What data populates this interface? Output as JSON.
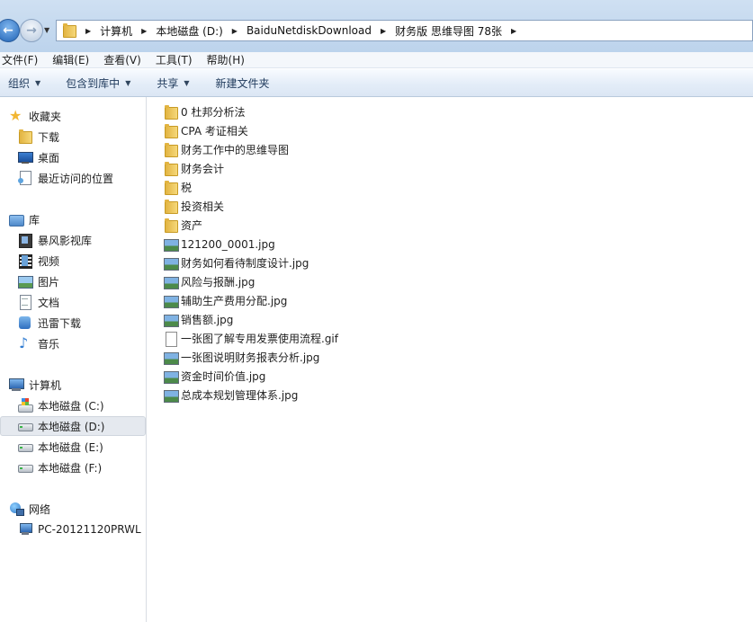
{
  "address": {
    "crumbs": [
      "计算机",
      "本地磁盘 (D:)",
      "BaiduNetdiskDownload",
      "财务版 思维导图 78张"
    ]
  },
  "menubar": {
    "items": [
      "文件(F)",
      "编辑(E)",
      "查看(V)",
      "工具(T)",
      "帮助(H)"
    ]
  },
  "toolbar": {
    "organize": "组织",
    "include_library": "包含到库中",
    "share": "共享",
    "new_folder": "新建文件夹"
  },
  "navpane": {
    "favorites": "收藏夹",
    "fav_items": [
      "下载",
      "桌面",
      "最近访问的位置"
    ],
    "libraries": "库",
    "lib_items": [
      "暴风影视库",
      "视频",
      "图片",
      "文档",
      "迅雷下载",
      "音乐"
    ],
    "computer": "计算机",
    "drives": [
      "本地磁盘 (C:)",
      "本地磁盘 (D:)",
      "本地磁盘 (E:)",
      "本地磁盘 (F:)"
    ],
    "network": "网络",
    "network_items": [
      "PC-20121120PRWL"
    ]
  },
  "files": [
    {
      "name": "0 杜邦分析法",
      "type": "folder"
    },
    {
      "name": "CPA 考证相关",
      "type": "folder"
    },
    {
      "name": "财务工作中的思维导图",
      "type": "folder"
    },
    {
      "name": "财务会计",
      "type": "folder"
    },
    {
      "name": "税",
      "type": "folder"
    },
    {
      "name": "投资相关",
      "type": "folder"
    },
    {
      "name": "资产",
      "type": "folder"
    },
    {
      "name": "121200_0001.jpg",
      "type": "image"
    },
    {
      "name": "财务如何看待制度设计.jpg",
      "type": "image"
    },
    {
      "name": "风险与报酬.jpg",
      "type": "image"
    },
    {
      "name": "辅助生产费用分配.jpg",
      "type": "image"
    },
    {
      "name": "销售额.jpg",
      "type": "image"
    },
    {
      "name": "一张图了解专用发票使用流程.gif",
      "type": "document"
    },
    {
      "name": "一张图说明财务报表分析.jpg",
      "type": "image"
    },
    {
      "name": "资金时间价值.jpg",
      "type": "image"
    },
    {
      "name": "总成本规划管理体系.jpg",
      "type": "image"
    }
  ],
  "colors": {
    "titlebar": "#cfe0f2",
    "toolbar_text": "#1e395b",
    "selected_bg": "#e5e9ef"
  }
}
